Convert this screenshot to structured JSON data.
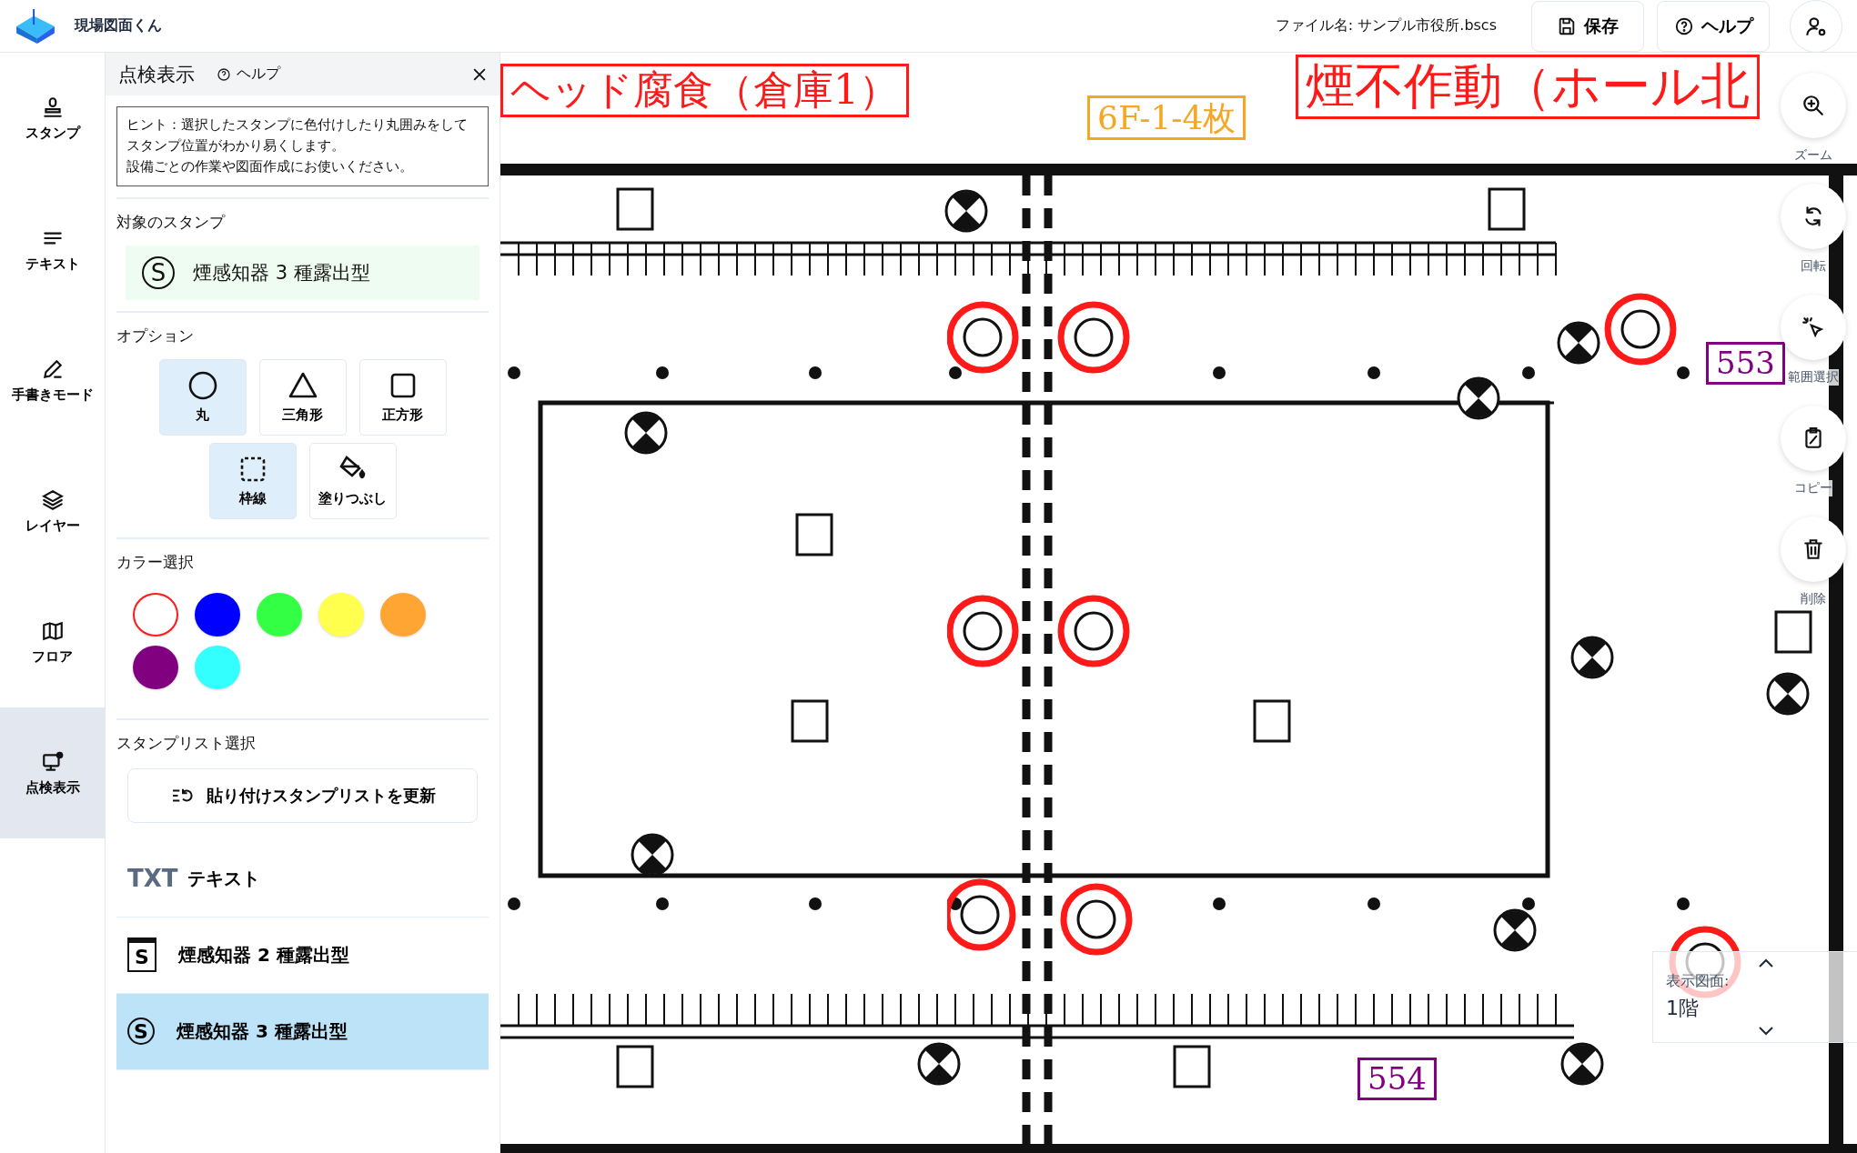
{
  "app": {
    "title": "現場図面くん"
  },
  "header": {
    "file_label": "ファイル名: サンプル市役所.bscs",
    "buttons": [
      {
        "label": "保存"
      },
      {
        "label": "ヘルプ"
      }
    ]
  },
  "rail": [
    {
      "label": "スタンプ",
      "selected": false
    },
    {
      "label": "テキスト",
      "selected": false
    },
    {
      "label": "手書きモード",
      "selected": false
    },
    {
      "label": "レイヤー",
      "selected": false
    },
    {
      "label": "フロア",
      "selected": false
    },
    {
      "label": "点検表示",
      "selected": true
    }
  ],
  "panel": {
    "title": "点検表示",
    "help": "ヘルプ",
    "hint": [
      "ヒント：選択したスタンプに色付けしたり丸囲みをしてスタンプ位置がわかり易くします。",
      "設備ごとの作業や図面作成にお使いください。"
    ],
    "target": {
      "label": "対象のスタンプ",
      "symbol": "S",
      "name": "煙感知器 3 種露出型"
    },
    "options": {
      "label": "オプション",
      "shapes": [
        {
          "label": "丸",
          "kind": "circle",
          "selected": true
        },
        {
          "label": "三角形",
          "kind": "triangle",
          "selected": false
        },
        {
          "label": "正方形",
          "kind": "square",
          "selected": false
        }
      ],
      "styles": [
        {
          "label": "枠線",
          "kind": "outline",
          "selected": true
        },
        {
          "label": "塗りつぶし",
          "kind": "fill",
          "selected": false
        }
      ]
    },
    "colors": {
      "label": "カラー選択",
      "swatches": [
        {
          "color": "#ffffff",
          "selected": true
        },
        {
          "color": "#0000ff",
          "selected": false
        },
        {
          "color": "#33ff44",
          "selected": false
        },
        {
          "color": "#ffff4d",
          "selected": false
        },
        {
          "color": "#ffa533",
          "selected": false
        },
        {
          "color": "#800080",
          "selected": false
        },
        {
          "color": "#33ffff",
          "selected": false
        }
      ]
    },
    "stamp_list": {
      "label": "スタンプリスト選択",
      "button": "貼り付けスタンプリストを更新",
      "items": [
        {
          "kind": "text",
          "symbol": "TXT",
          "label": "テキスト",
          "selected": false
        },
        {
          "kind": "square",
          "symbol": "S",
          "label": "煙感知器 2 種露出型",
          "selected": false
        },
        {
          "kind": "circle",
          "symbol": "S",
          "label": "煙感知器 3 種露出型",
          "selected": true
        }
      ]
    }
  },
  "canvas": {
    "annotations": [
      {
        "text": "ヘッド腐食（倉庫1）",
        "color": "#ff1a1a"
      },
      {
        "text": "6F-1-4枚",
        "color": "#f5a623"
      },
      {
        "text": "煙不作動（ホール北",
        "color": "#ff1a1a"
      },
      {
        "text": "553",
        "color": "#800080"
      },
      {
        "text": "554",
        "color": "#800080"
      }
    ],
    "tools": [
      {
        "label": "ズーム"
      },
      {
        "label": "回転"
      },
      {
        "label": "範囲選択"
      },
      {
        "label": "コピー"
      },
      {
        "label": "削除"
      }
    ],
    "floor": {
      "label": "表示図面:",
      "value": "1階"
    }
  }
}
